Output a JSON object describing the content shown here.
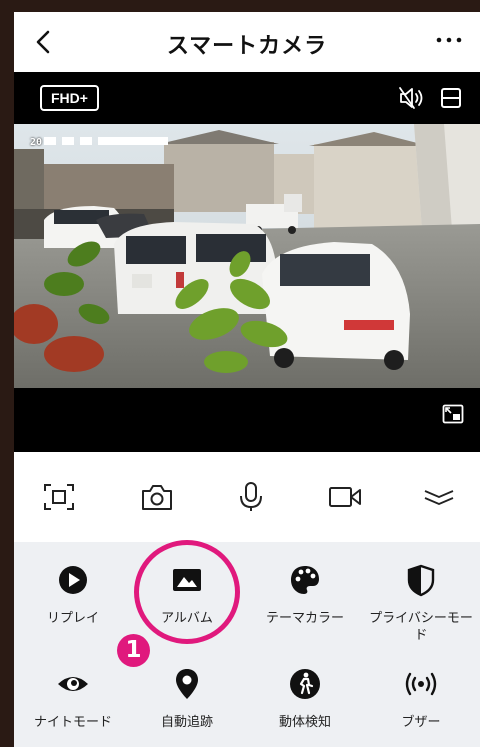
{
  "header": {
    "title": "スマートカメラ"
  },
  "video": {
    "quality_label": "FHD+",
    "osd_text": "20 ■ ■ ■ ■ ■ ■ ■ ■"
  },
  "toolbar": {
    "icons": [
      "screenshot-icon",
      "camera-icon",
      "microphone-icon",
      "video-record-icon",
      "collapse-icon"
    ]
  },
  "features": {
    "replay": "リプレイ",
    "album": "アルバム",
    "theme_color": "テーマカラー",
    "privacy_mode": "プライバシーモード",
    "night_mode": "ナイトモード",
    "auto_tracking": "自動追跡",
    "motion_detection": "動体検知",
    "buzzer": "ブザー"
  },
  "annotation": {
    "step_number": "1",
    "highlight_color": "#e0197d"
  }
}
